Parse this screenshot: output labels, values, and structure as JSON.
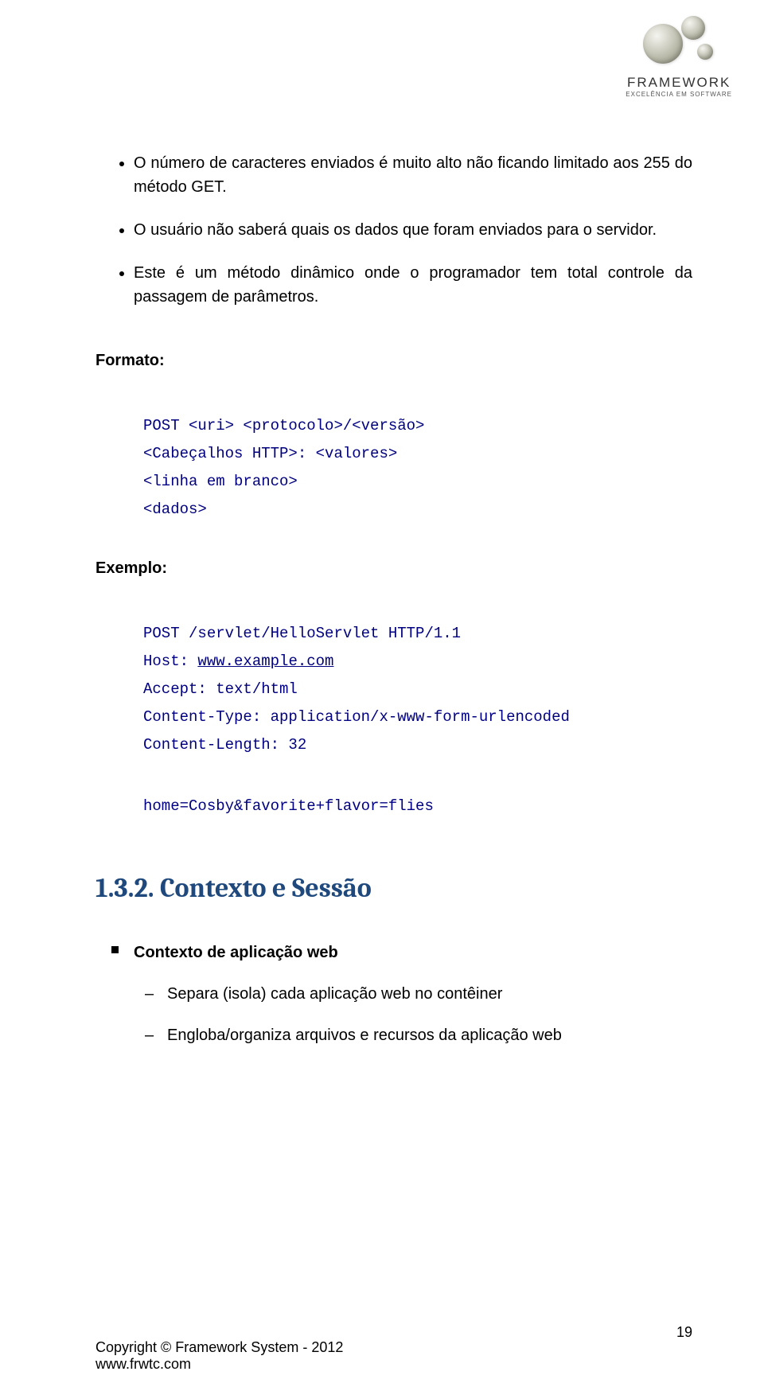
{
  "logo": {
    "brand": "FRAMEWORK",
    "tagline": "EXCELÊNCIA EM SOFTWARE"
  },
  "bullets": [
    "O número de caracteres enviados é muito alto não ficando limitado aos 255 do método GET.",
    "O usuário não saberá quais os dados que foram enviados para o servidor.",
    "Este é um método dinâmico onde o programador tem total controle da passagem de parâmetros."
  ],
  "formato_label": "Formato:",
  "formato_code": {
    "l1": "POST <uri> <protocolo>/<versão>",
    "l2": "<Cabeçalhos HTTP>: <valores>",
    "l3": "<linha em branco>",
    "l4": "<dados>"
  },
  "exemplo_label": "Exemplo:",
  "exemplo_code": {
    "l1": "POST /servlet/HelloServlet HTTP/1.1",
    "l2a": "Host: ",
    "l2b": "www.example.com",
    "l3": "Accept: text/html",
    "l4": "Content-Type: application/x-www-form-urlencoded",
    "l5": "Content-Length: 32",
    "l6": "home=Cosby&favorite+flavor=flies"
  },
  "heading": "1.3.2. Contexto e Sessão",
  "context": {
    "title": "Contexto de aplicação web",
    "items": [
      "Separa (isola) cada aplicação web no contêiner",
      "Engloba/organiza arquivos e recursos da aplicação web"
    ]
  },
  "footer": {
    "copyright": "Copyright © Framework System - 2012",
    "url": "www.frwtc.com",
    "page": "19"
  }
}
